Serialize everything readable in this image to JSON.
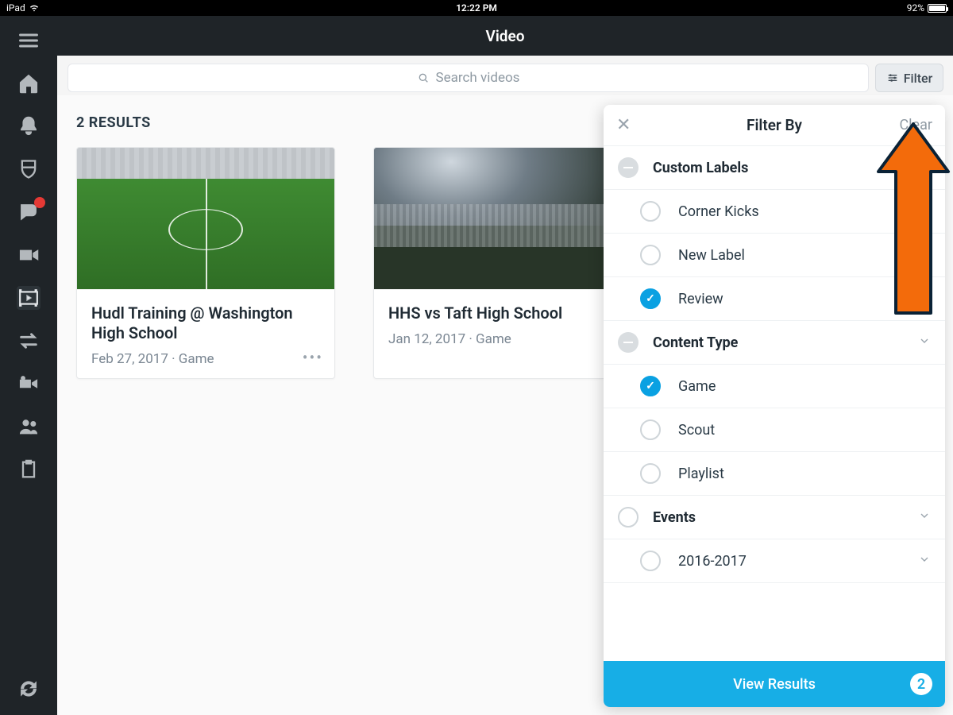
{
  "statusbar": {
    "device": "iPad",
    "time": "12:22 PM",
    "battery_pct": "92%"
  },
  "header": {
    "title": "Video"
  },
  "search": {
    "placeholder": "Search videos"
  },
  "filter_button": {
    "label": "Filter"
  },
  "results": {
    "label": "2 RESULTS"
  },
  "cards": [
    {
      "title": "Hudl Training @ Washington High School",
      "meta": "Feb 27, 2017 · Game"
    },
    {
      "title": "HHS vs Taft High School",
      "meta": "Jan 12, 2017 · Game"
    }
  ],
  "filter_panel": {
    "title": "Filter By",
    "clear": "Clear",
    "sections": [
      {
        "label": "Custom Labels",
        "toggle": "minus",
        "options": [
          {
            "label": "Corner Kicks",
            "checked": false
          },
          {
            "label": "New Label",
            "checked": false
          },
          {
            "label": "Review",
            "checked": true
          }
        ]
      },
      {
        "label": "Content Type",
        "toggle": "minus",
        "chevron": true,
        "options": [
          {
            "label": "Game",
            "checked": true
          },
          {
            "label": "Scout",
            "checked": false
          },
          {
            "label": "Playlist",
            "checked": false
          }
        ]
      },
      {
        "label": "Events",
        "toggle": "empty",
        "chevron": true,
        "options": [
          {
            "label": "2016-2017",
            "checked": false,
            "chevron": true
          }
        ]
      }
    ],
    "footer": {
      "label": "View Results",
      "count": "2"
    }
  },
  "sidebar_icons": [
    "menu-icon",
    "home-icon",
    "bell-icon",
    "shield-icon",
    "chat-icon",
    "camera-icon",
    "play-icon",
    "transfer-icon",
    "record-icon",
    "people-icon",
    "clipboard-icon"
  ],
  "colors": {
    "accent": "#17aee6",
    "arrow": "#f36b0b"
  }
}
